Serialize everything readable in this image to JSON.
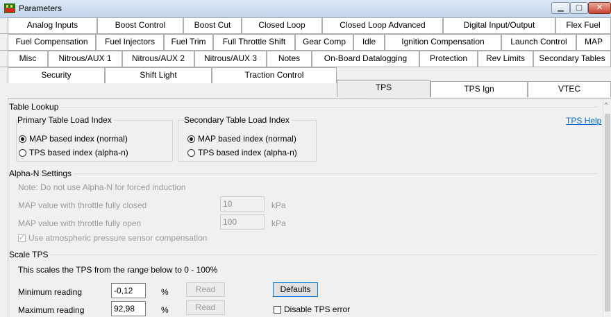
{
  "window": {
    "title": "Parameters"
  },
  "tabs": {
    "row1": [
      "Analog Inputs",
      "Boost Control",
      "Boost Cut",
      "Closed Loop",
      "Closed Loop Advanced",
      "Digital Input/Output",
      "Flex Fuel"
    ],
    "row2": [
      "Fuel Compensation",
      "Fuel Injectors",
      "Fuel Trim",
      "Full Throttle Shift",
      "Gear Comp",
      "Idle",
      "Ignition Compensation",
      "Launch Control",
      "MAP"
    ],
    "row3": [
      "Misc",
      "Nitrous/AUX 1",
      "Nitrous/AUX 2",
      "Nitrous/AUX 3",
      "Notes",
      "On-Board Datalogging",
      "Protection",
      "Rev Limits",
      "Secondary Tables"
    ],
    "row4": [
      "Security",
      "Shift Light",
      "Traction Control",
      "TPS",
      "TPS Ign",
      "VTEC"
    ],
    "active": "TPS"
  },
  "table_lookup": {
    "title": "Table Lookup",
    "help_link": "TPS Help",
    "primary": {
      "title": "Primary Table Load Index",
      "options": [
        "MAP based index (normal)",
        "TPS based index (alpha-n)"
      ],
      "selected": "MAP based index (normal)"
    },
    "secondary": {
      "title": "Secondary Table Load Index",
      "options": [
        "MAP based index (normal)",
        "TPS based index (alpha-n)"
      ],
      "selected": "MAP based index (normal)"
    }
  },
  "alpha_n": {
    "title": "Alpha-N Settings",
    "note": "Note: Do not use Alpha-N for forced induction",
    "closed_label": "MAP value with throttle fully closed",
    "closed_value": "10",
    "open_label": "MAP value with throttle fully open",
    "open_value": "100",
    "unit": "kPa",
    "atm_label": "Use atmospheric pressure sensor compensation",
    "atm_checked": true
  },
  "scale_tps": {
    "title": "Scale TPS",
    "description": "This scales the TPS from the range below to 0 - 100%",
    "min_label": "Minimum reading",
    "min_value": "-0,12",
    "max_label": "Maximum reading",
    "max_value": "92,98",
    "unit": "%",
    "read_label": "Read",
    "defaults_label": "Defaults",
    "disable_error_label": "Disable TPS error",
    "disable_error_checked": false
  }
}
